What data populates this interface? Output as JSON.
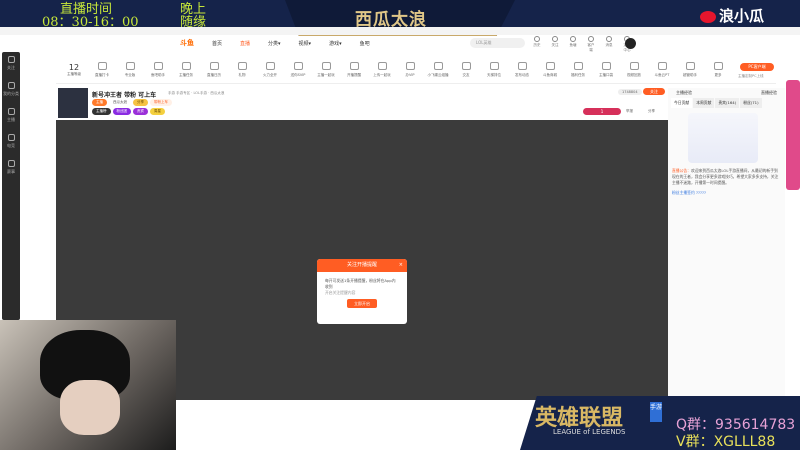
{
  "overlay": {
    "schedule": {
      "label": "直播时间",
      "time": "08：30-16：00",
      "evening_label": "晚上",
      "evening_value": "随缘"
    },
    "streamer_name": "西瓜太浪",
    "weibo_name": "浪小瓜",
    "game_logo": "英雄联盟",
    "game_logo_sub": "LEAGUE of LEGENDS",
    "game_logo_badge": "手游",
    "qq_group": "Q群：935614783",
    "wechat_group": "V群：XGLLL88"
  },
  "nav": {
    "logo": "斗鱼",
    "items": [
      "首页",
      "直播",
      "分类▾",
      "视频▾",
      "游戏▾",
      "鱼吧"
    ],
    "active_index": 1,
    "search_placeholder": "LOL英雄"
  },
  "user_icons": [
    "历史",
    "关注",
    "鱼塘",
    "客户端",
    "消息",
    "定位中心"
  ],
  "sidebar": [
    "关注",
    "我的分类",
    "主播",
    "电竞",
    "赛事"
  ],
  "toolbar": {
    "level_num": "12",
    "level_label": "主播等级",
    "items": [
      "直播打卡",
      "专业版",
      "鱼吧助手",
      "主播任务",
      "直播日历",
      "礼物",
      "火力全开",
      "送你SVIP",
      "主播一起玩",
      "开播提醒",
      "上传一起玩",
      "办VIP",
      "小飞碟云组播",
      "交友",
      "天梯排位",
      "发布动态",
      "斗鱼商城",
      "福利任务",
      "主播口袋",
      "视频回放",
      "斗鱼云PT",
      "超管助手",
      "更多"
    ],
    "pc_button": "PC客户端",
    "pc_sub": "主播定制PC上线"
  },
  "room": {
    "title": "新号冲王者 带粉 可上车",
    "category": "手游",
    "meta": "手游专区 · LOL手游 · 西瓜太浪",
    "tags": [
      "主播",
      "西瓜太浪",
      "分享",
      "带粉上车"
    ],
    "badges": [
      "主播榜",
      "粉丝团",
      "贵宾",
      "周星"
    ],
    "follow_count": "1748804",
    "follow_label": "关注",
    "rank": "1",
    "report": "举报",
    "share": "分享"
  },
  "right_panel": {
    "top_links": [
      "主播经验",
      "直播经验"
    ],
    "tabs": [
      "今日贡献",
      "本周贡献",
      "贵宾(164)",
      "粉丝(71)"
    ],
    "notice_label": "直播公告：",
    "notice": "欢迎来到西瓜太浪LOL手游直播间，从最初的新手到现在的王者，我会分享更多游戏技巧，希望大家多多支持，关注主播不迷路，开播第一时间提醒。",
    "fan_link": "粉丝主播签约 ?????"
  },
  "dialog": {
    "title": "关注开播提醒",
    "close": "×",
    "body": "每开可发送1条开播提醒，粉丝将在App内收到",
    "sub": "开启关注提醒内容",
    "button": "立即开启"
  }
}
